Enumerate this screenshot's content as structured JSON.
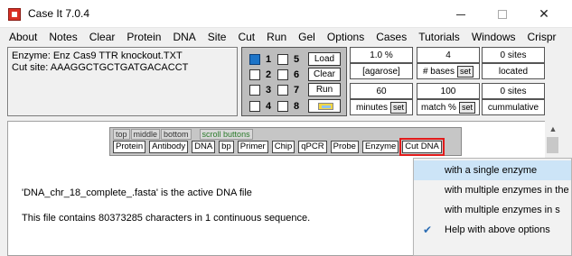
{
  "window": {
    "title": "Case It 7.0.4",
    "minimize_icon": "minimize-icon",
    "maximize_icon": "maximize-icon",
    "close_label": "✕"
  },
  "menu": [
    "About",
    "Notes",
    "Clear",
    "Protein",
    "DNA",
    "Site",
    "Cut",
    "Run",
    "Gel",
    "Options",
    "Cases",
    "Tutorials",
    "Windows",
    "Crispr"
  ],
  "info": {
    "line1": "Enzyme: Enz Cas9 TTR knockout.TXT",
    "line2": "Cut site: AAAGGCTGCTGATGACACCT"
  },
  "lanes": {
    "rows": [
      {
        "a": "1",
        "b": "5",
        "button": "Load"
      },
      {
        "a": "2",
        "b": "6",
        "button": "Clear"
      },
      {
        "a": "3",
        "b": "7",
        "button": "Run"
      },
      {
        "a": "4",
        "b": "8",
        "button": ""
      }
    ],
    "checked_lane": "1"
  },
  "agarose": {
    "value": "1.0 %",
    "label": "[agarose]",
    "time_value": "60",
    "time_label": "minutes",
    "set_label": "set"
  },
  "bases": {
    "value": "4",
    "label": "# bases",
    "match_value": "100",
    "match_label": "match %",
    "set_label": "set"
  },
  "sites": {
    "value1": "0 sites",
    "label1": "located",
    "value2": "0 sites",
    "label2": "cummulative"
  },
  "button_panel": {
    "tabs": [
      "top",
      "middle",
      "bottom"
    ],
    "scroll_tab": "scroll buttons",
    "tools": [
      "Protein",
      "Antibody",
      "DNA",
      "bp",
      "Primer",
      "Chip",
      "qPCR",
      "Probe",
      "Enzyme",
      "Cut DNA"
    ]
  },
  "main_text": {
    "active_file": "'DNA_chr_18_complete_.fasta' is the active DNA file",
    "summary": "This file contains 80373285 characters in 1 continuous sequence."
  },
  "dropdown": {
    "items": [
      {
        "label": "with a single enzyme",
        "hover": true
      },
      {
        "label": "with multiple enzymes in the",
        "hover": false
      },
      {
        "label": "with multiple enzymes in s",
        "hover": false
      },
      {
        "label": "Help with above options",
        "checked": true
      }
    ]
  },
  "colors": {
    "highlight_box": "#e21b1b",
    "menu_hover": "#cce4f7",
    "checked_lane": "#1c74c8"
  }
}
